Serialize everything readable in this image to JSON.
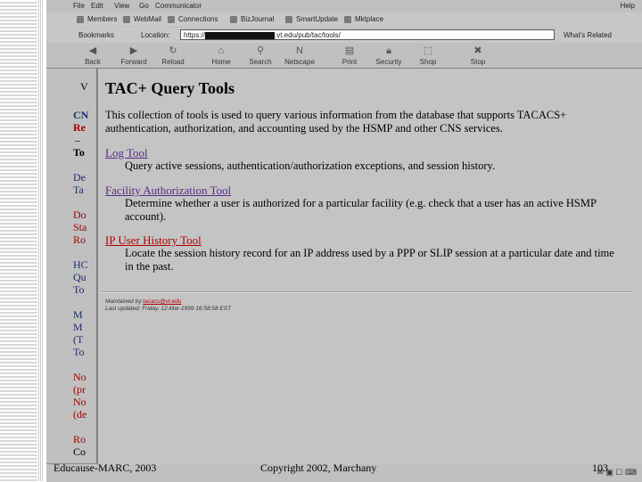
{
  "menubar": {
    "items": [
      "File",
      "Edit",
      "View",
      "Go",
      "Communicator"
    ],
    "help": "Help"
  },
  "personal_toolbar": {
    "items": [
      "Members",
      "WebMail",
      "Connections",
      "BizJournal",
      "SmartUpdate",
      "Mktplace"
    ]
  },
  "location_bar": {
    "bookmarks_label": "Bookmarks",
    "location_label": "Location:",
    "url_prefix": "https://",
    "url_suffix": ".vt.edu/pub/tac/tools/",
    "related_label": "What's Related"
  },
  "nav_toolbar": {
    "buttons": [
      {
        "label": "Back",
        "icon": "back-arrow-icon"
      },
      {
        "label": "Forward",
        "icon": "forward-arrow-icon"
      },
      {
        "label": "Reload",
        "icon": "reload-icon"
      },
      {
        "label": "Home",
        "icon": "home-icon"
      },
      {
        "label": "Search",
        "icon": "search-icon"
      },
      {
        "label": "Netscape",
        "icon": "netscape-icon"
      },
      {
        "label": "Print",
        "icon": "print-icon"
      },
      {
        "label": "Security",
        "icon": "security-lock-icon"
      },
      {
        "label": "Shop",
        "icon": "shop-icon"
      },
      {
        "label": "Stop",
        "icon": "stop-icon"
      }
    ]
  },
  "back_page": {
    "fragments": [
      "V",
      "CN",
      "Re",
      "–",
      "To",
      "De",
      "Ta",
      "Do",
      "Sta",
      "Ro",
      "HC",
      "Qu",
      "To",
      "M",
      "M",
      "(T",
      "To",
      "No",
      "(pr",
      "No",
      "(de",
      "Ro",
      "Co"
    ]
  },
  "front_page": {
    "title": "TAC+ Query Tools",
    "intro": "This collection of tools is used to query various information from the database that supports TACACS+ authentication, authorization, and accounting used by the HSMP and other CNS services.",
    "tools": [
      {
        "name": "Log Tool",
        "description": "Query active sessions, authentication/authorization exceptions, and session history."
      },
      {
        "name": "Facility Authorization Tool",
        "description": "Determine whether a user is authorized for a particular facility (e.g. check that a user has an active HSMP account)."
      },
      {
        "name": "IP User History Tool",
        "description": "Locate the session history record for an IP address used by a PPP or SLIP session at a particular date and time in the past."
      }
    ],
    "footer_maintained_label": "Maintained by",
    "footer_maintainer": "tacacs@vt.edu",
    "footer_modified": "Last updated: Friday, 12-Mar-1999 16:58:58 EST"
  },
  "slide_footer": {
    "left": "Educause-MARC, 2003",
    "center": "Copyright 2002, Marchany",
    "page_number": "103"
  }
}
